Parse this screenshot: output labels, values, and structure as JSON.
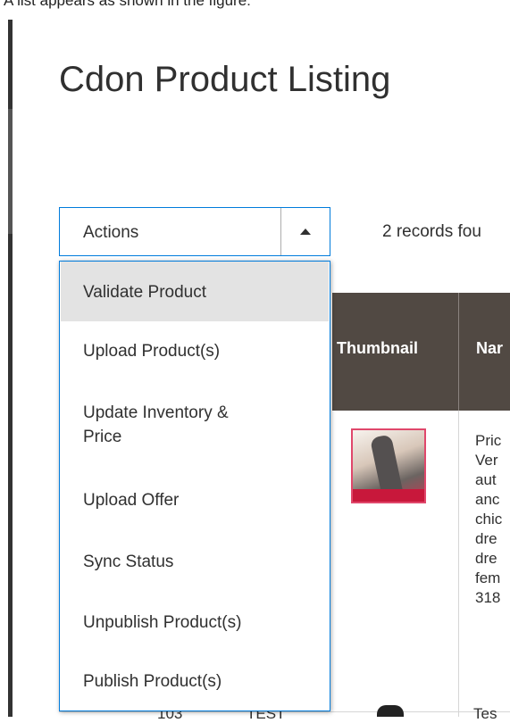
{
  "caption": "A list appears as shown in the figure:",
  "page_title": "Cdon Product Listing",
  "actions": {
    "label": "Actions",
    "menu_items": [
      {
        "label": "Validate Product"
      },
      {
        "label": "Upload Product(s)"
      },
      {
        "label": "Update Inventory &"
      },
      {
        "label": "Price"
      },
      {
        "label": "Upload Offer"
      },
      {
        "label": "Sync Status"
      },
      {
        "label": "Unpublish Product(s)"
      },
      {
        "label": "Publish Product(s)"
      }
    ]
  },
  "records_text": "2 records fou",
  "grid": {
    "headers": {
      "thumbnail": "Thumbnail",
      "name": "Nar"
    },
    "row1_name_lines": [
      "Pric",
      "Ver",
      "aut",
      "anc",
      "chic",
      "dre",
      "dre",
      "fem",
      "318"
    ],
    "row2": {
      "col_a": "103",
      "col_b": "TEST",
      "col_c": "Tes"
    }
  },
  "colors": {
    "accent": "#007bdb",
    "header_bg": "#514943",
    "active_item_bg": "#e3e3e3"
  }
}
